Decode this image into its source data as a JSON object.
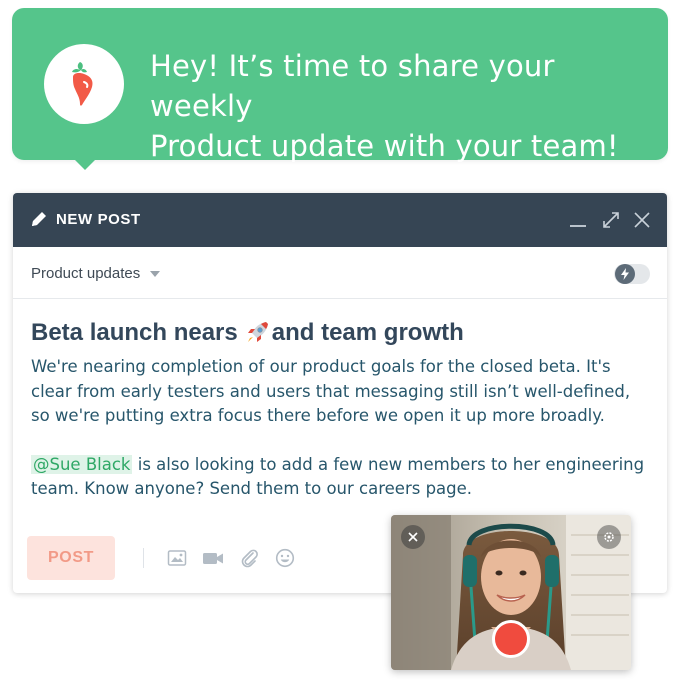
{
  "banner": {
    "line1": "Hey! It’s time to share your weekly",
    "line2": "Product update with your team!",
    "logo_icon": "carrot-logo-icon",
    "background": "#55c58b"
  },
  "window": {
    "title": "NEW POST",
    "header_color": "#364554",
    "icons": [
      "pencil-icon",
      "minimize-icon",
      "expand-icon",
      "close-icon"
    ]
  },
  "toolbar": {
    "category": "Product updates",
    "toggle_on": false,
    "toggle_icon": "lightning-icon"
  },
  "post": {
    "heading_part1": "Beta launch nears ",
    "heading_part2": "and team growth",
    "para1": "We're nearing completion of our product goals for the closed beta. It's clear from early testers and users that messaging still isn’t well-defined, so we're putting extra focus there before we open it up more broadly.",
    "mention": "@Sue Black",
    "para2_rest": " is also looking to add a few new members to her engineering team. Know anyone? Send them to our careers page."
  },
  "footer": {
    "post_label": "POST",
    "tools": [
      "image-icon",
      "video-camera-icon",
      "paperclip-icon",
      "emoji-icon"
    ]
  },
  "video": {
    "icons": [
      "close-icon",
      "gear-icon",
      "record-icon"
    ]
  }
}
